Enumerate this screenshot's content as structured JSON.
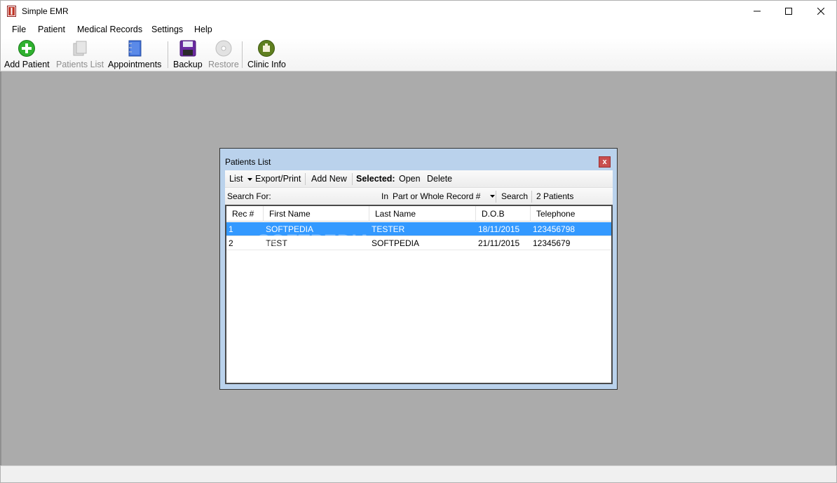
{
  "window": {
    "title": "Simple EMR"
  },
  "menu": [
    "File",
    "Patient",
    "Medical Records",
    "Settings",
    "Help"
  ],
  "toolbar": {
    "add_patient": "Add Patient",
    "patients_list": "Patients List",
    "appointments": "Appointments",
    "backup": "Backup",
    "restore": "Restore",
    "clinic_info": "Clinic Info"
  },
  "child": {
    "title": "Patients List",
    "close_glyph": "x",
    "toolbar": {
      "list": "List",
      "export_print": "Export/Print",
      "add_new": "Add New",
      "selected": "Selected:",
      "open": "Open",
      "delete": "Delete"
    },
    "search": {
      "label": "Search For:",
      "value": "",
      "in_label": "In",
      "field_option": "Part or Whole Record #",
      "search_button": "Search",
      "count": "2 Patients"
    },
    "columns": [
      "Rec #",
      "First Name",
      "Last Name",
      "D.O.B",
      "Telephone"
    ],
    "rows": [
      [
        "1",
        "SOFTPEDIA",
        "TESTER",
        "18/11/2015",
        "123456798"
      ],
      [
        "2",
        "TEST",
        "SOFTPEDIA",
        "21/11/2015",
        "12345679"
      ]
    ],
    "selected_row": 0
  },
  "watermark": "SOFTPEDIA",
  "colors": {
    "mdi_background": "#ababab",
    "selection": "#3399ff",
    "child_frame": "#bad2ec"
  }
}
